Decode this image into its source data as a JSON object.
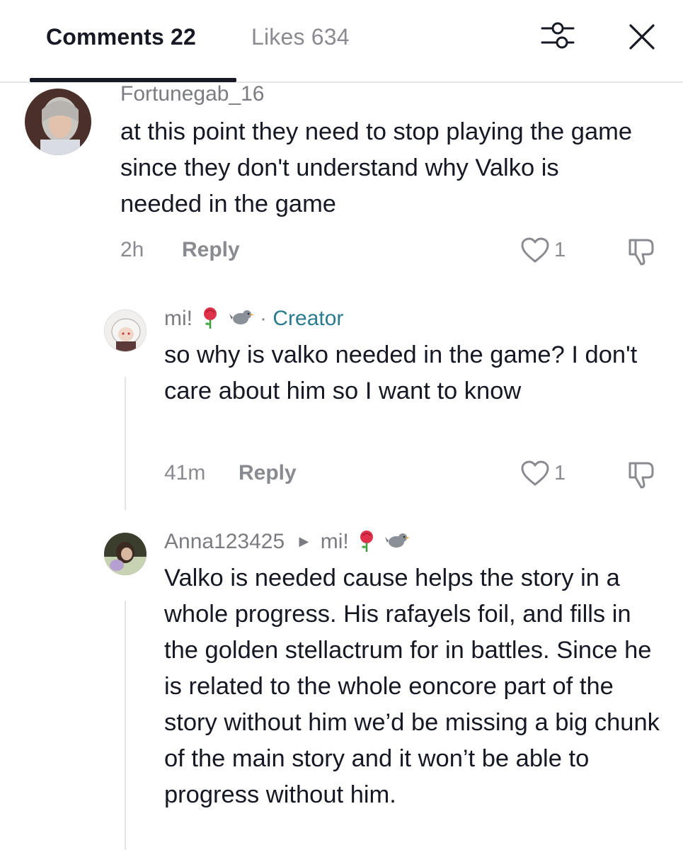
{
  "header": {
    "comments_label": "Comments 22",
    "likes_label": "Likes 634",
    "filter_icon": "filter-sliders-icon",
    "close_icon": "close-icon"
  },
  "comments": [
    {
      "username": "Fortunegab_16",
      "text": "at this point they need to stop playing the game since they don't understand why Valko is needed in the game",
      "time": "2h",
      "reply_label": "Reply",
      "likes": "1"
    },
    {
      "username": "mi!",
      "badge_separator": "·",
      "badge": "Creator",
      "text": "so why is valko needed in the game? I don't care about him so I want to know",
      "time": "41m",
      "reply_label": "Reply",
      "likes": "1"
    },
    {
      "username": "Anna123425",
      "reply_to": "mi!",
      "text": "Valko is needed cause helps the story in a whole progress. His rafayels foil, and fills in the golden stellactrum for in battles. Since he is related to the whole eoncore part of the story without him we’d be missing a big chunk of the main story and it won’t be able to progress without him."
    }
  ],
  "colors": {
    "accent_creator": "#2a7b8e",
    "muted": "#8a8b91",
    "text": "#161823"
  }
}
